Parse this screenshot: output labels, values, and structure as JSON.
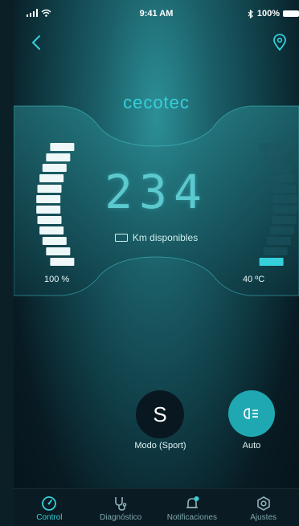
{
  "status_bar": {
    "time": "9:41 AM",
    "battery": "100%",
    "icons": [
      "signal-icon",
      "wifi-icon",
      "bluetooth-icon",
      "battery-icon"
    ]
  },
  "header": {
    "brand": "cecotec",
    "back_icon": "chevron-left-icon",
    "location_icon": "location-pin-icon"
  },
  "dashboard": {
    "range_value": "234",
    "range_label": "Km disponibles",
    "battery_label": "100 %",
    "battery_level": 1.0,
    "temperature_label": "40 ºC",
    "temperature_level": 0.1
  },
  "controls": {
    "mode_letter": "S",
    "mode_label": "Modo (Sport)",
    "lights_label": "Auto",
    "lights_icon": "headlight-icon"
  },
  "tabs": [
    {
      "label": "Control",
      "icon": "speedometer-icon",
      "active": true
    },
    {
      "label": "Diagnóstico",
      "icon": "stethoscope-icon",
      "active": false
    },
    {
      "label": "Notificaciones",
      "icon": "bell-icon",
      "active": false
    },
    {
      "label": "Ajustes",
      "icon": "settings-hexagon-icon",
      "active": false
    }
  ],
  "colors": {
    "accent": "#35d0da",
    "bar_on": "#eef8f8",
    "bar_off": "#1b5660"
  }
}
